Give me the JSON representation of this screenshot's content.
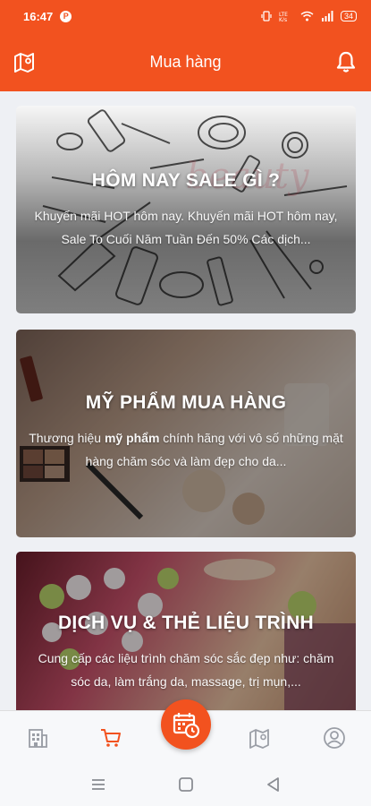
{
  "status_bar": {
    "time": "16:47",
    "battery": "34"
  },
  "app_bar": {
    "title": "Mua hàng",
    "left_icon": "map-icon",
    "right_icon": "bell-icon"
  },
  "cards": [
    {
      "title": "HÔM NAY SALE GÌ ?",
      "description": "Khuyến mãi HOT hôm nay. Khuyến mãi HOT hôm nay, Sale To Cuối Năm Tuần Đến 50% Các dịch..."
    },
    {
      "title": "MỸ PHẨM MUA HÀNG",
      "description_pre": "Thương hiệu ",
      "description_bold": "mỹ phẩm",
      "description_post": " chính hãng với vô số những mặt hàng chăm sóc và làm đẹp cho da..."
    },
    {
      "title": "DỊCH VỤ & THẺ LIỆU TRÌNH",
      "description": "Cung cấp các liệu trình chăm sóc sắc đẹp như: chăm sóc da, làm trắng da, massage, trị mụn,..."
    }
  ],
  "bottom_nav": {
    "items": [
      "building-icon",
      "cart-icon",
      "calendar-clock-icon",
      "map-pin-icon",
      "user-icon"
    ],
    "active": "cart-icon"
  },
  "colors": {
    "primary": "#f2521f",
    "nav_inactive": "#9a9ea6"
  }
}
